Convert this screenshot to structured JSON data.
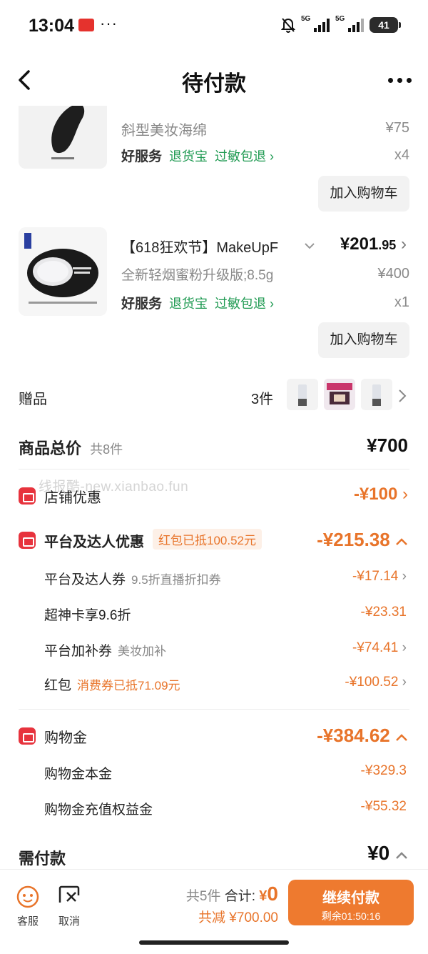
{
  "status_bar": {
    "time": "13:04",
    "app_badge": "百亿补贴",
    "more_dots": "···",
    "signal1_label": "5G",
    "signal2_label": "5G",
    "battery": "41"
  },
  "nav": {
    "title": "待付款"
  },
  "products": [
    {
      "name": "斜型美妆海绵",
      "price_original": "¥75",
      "quantity": "x4",
      "service_good": "好服务",
      "service_1": "退货宝",
      "service_2": "过敏包退 ›",
      "add_cart": "加入购物车"
    },
    {
      "name": "【618狂欢节】MakeUpF",
      "price_now_main": "¥201",
      "price_now_dec": ".95",
      "spec": "全新轻烟蜜粉升级版;8.5g",
      "price_original": "¥400",
      "quantity": "x1",
      "service_good": "好服务",
      "service_1": "退货宝",
      "service_2": "过敏包退 ›",
      "add_cart": "加入购物车"
    }
  ],
  "gifts": {
    "label": "赠品",
    "count": "3件"
  },
  "summary": {
    "total_label": "商品总价",
    "total_count": "共8件",
    "total_value": "¥700",
    "store_discount_label": "店铺优惠",
    "store_discount_value": "-¥100",
    "platform_label": "平台及达人优惠",
    "platform_tag": "红包已抵100.52元",
    "platform_value": "-¥215.38",
    "platform_items": [
      {
        "label": "平台及达人券",
        "note": "9.5折直播折扣券",
        "value": "-¥17.14"
      },
      {
        "label": "超神卡享9.6折",
        "note": "",
        "value": "-¥23.31"
      },
      {
        "label": "平台加补券",
        "note": "美妆加补",
        "value": "-¥74.41"
      },
      {
        "label": "红包",
        "note": "消费券已抵71.09元",
        "value": "-¥100.52"
      }
    ],
    "shopping_gold_label": "购物金",
    "shopping_gold_value": "-¥384.62",
    "shopping_gold_items": [
      {
        "label": "购物金本金",
        "value": "-¥329.3"
      },
      {
        "label": "购物金充值权益金",
        "value": "-¥55.32"
      }
    ],
    "payable_label": "需付款",
    "payable_value": "¥0"
  },
  "watermark": "线报酷-new.xianbao.fun",
  "bottom_bar": {
    "service_label": "客服",
    "cancel_label": "取消",
    "item_count": "共5件",
    "total_label": "合计:",
    "total_symbol": "¥",
    "total_value": "0",
    "saved": "共减 ¥700.00",
    "pay_label": "继续付款",
    "remaining": "剩余01:50:16"
  },
  "colors": {
    "accent_orange": "#e8742a",
    "pay_button": "#ee7a2f",
    "green_service": "#1f9a52",
    "red_icon": "#e7333d"
  }
}
